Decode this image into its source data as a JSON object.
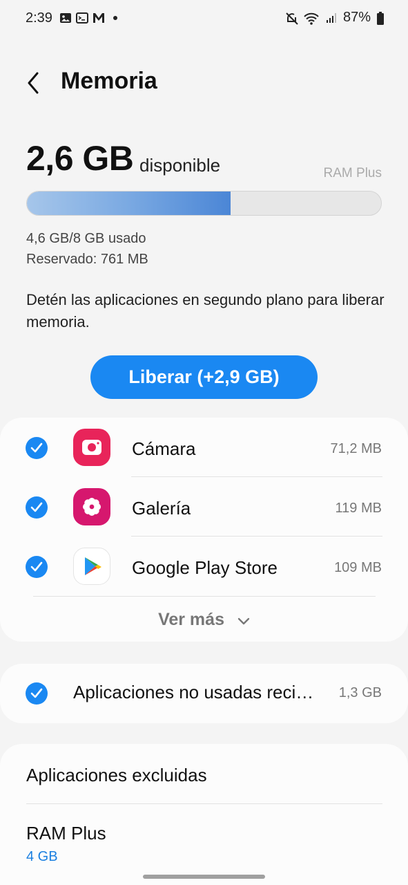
{
  "status_bar": {
    "time": "2:39",
    "battery": "87%"
  },
  "header": {
    "title": "Memoria"
  },
  "memory": {
    "available_value": "2,6 GB",
    "available_label": "disponible",
    "ram_plus_link": "RAM Plus",
    "used_fraction": 0.575,
    "used_text": "4,6 GB/8 GB usado",
    "reserved_text": "Reservado: 761 MB"
  },
  "description": "Detén las aplicaciones en segundo plano para liberar memoria.",
  "free_button_label": "Liberar (+2,9 GB)",
  "apps": [
    {
      "name": "Cámara",
      "size": "71,2 MB",
      "checked": true,
      "icon": "camera-icon",
      "color": "#e8245a"
    },
    {
      "name": "Galería",
      "size": "119 MB",
      "checked": true,
      "icon": "gallery-flower-icon",
      "color": "#d6176e"
    },
    {
      "name": "Google Play Store",
      "size": "109 MB",
      "checked": true,
      "icon": "google-play-icon",
      "color": "#ffffff"
    }
  ],
  "see_more_label": "Ver más",
  "unused_apps": {
    "label": "Aplicaciones no usadas reci…",
    "size": "1,3 GB",
    "checked": true
  },
  "settings": {
    "excluded_apps": "Aplicaciones excluidas",
    "ram_plus_label": "RAM Plus",
    "ram_plus_value": "4 GB"
  },
  "colors": {
    "accent": "#1a88f2",
    "link": "#1a7fe0"
  }
}
